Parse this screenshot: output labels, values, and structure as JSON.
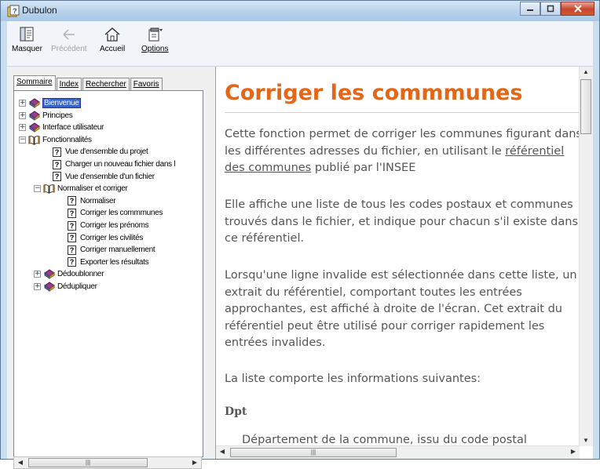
{
  "window": {
    "title": "Dubulon"
  },
  "toolbar": {
    "hide_label": "Masquer",
    "back_label": "Précédent",
    "home_label": "Accueil",
    "options_label": "Options"
  },
  "tabs": [
    "Sommaire",
    "Index",
    "Rechercher",
    "Favoris"
  ],
  "tree": [
    {
      "label": "Bienvenue",
      "icon": "book-icon",
      "expander": "+",
      "selected": true
    },
    {
      "label": "Principes",
      "icon": "book-icon",
      "expander": "+"
    },
    {
      "label": "Interface utilisateur",
      "icon": "book-icon",
      "expander": "+"
    },
    {
      "label": "Fonctionnalités",
      "icon": "open-book-icon",
      "expander": "-"
    },
    {
      "label": "Vue d'ensemble du projet",
      "icon": "help-page-icon"
    },
    {
      "label": "Charger un nouveau fichier dans l",
      "icon": "help-page-icon"
    },
    {
      "label": "Vue d'ensemble d'un fichier",
      "icon": "help-page-icon"
    },
    {
      "label": "Normaliser et corriger",
      "icon": "open-book-icon",
      "expander": "-"
    },
    {
      "label": "Normaliser",
      "icon": "help-page-icon"
    },
    {
      "label": "Corriger les commmunes",
      "icon": "help-page-icon"
    },
    {
      "label": "Corriger les prénoms",
      "icon": "help-page-icon"
    },
    {
      "label": "Corriger les civilités",
      "icon": "help-page-icon"
    },
    {
      "label": "Corriger manuellement",
      "icon": "help-page-icon"
    },
    {
      "label": "Exporter les résultats",
      "icon": "help-page-icon"
    },
    {
      "label": "Dédoublonner",
      "icon": "book-icon",
      "expander": "+"
    },
    {
      "label": "Dédupliquer",
      "icon": "book-icon",
      "expander": "+"
    }
  ],
  "doc": {
    "title": "Corriger les commmunes",
    "p1_before": "Cette fonction permet de corriger les communes figurant dans les différentes adresses du fichier, en utilisant le ",
    "p1_link": "référentiel des communes",
    "p1_after": " publié par l'INSEE",
    "p2": "Elle affiche une liste de tous les codes postaux et communes trouvés dans le fichier, et indique pour chacun s'il existe dans ce référentiel.",
    "p3": "Lorsqu'une ligne invalide est sélectionnée dans cette liste, un extrait du référentiel, comportant toutes les entrées approchantes, est affiché à droite de l'écran. Cet extrait du référentiel peut être utilisé pour corriger rapidement les entrées invalides.",
    "p4": "La liste comporte les informations suivantes:",
    "term": "Dpt",
    "term_def": "Département de la commune, issu du code postal"
  },
  "colors": {
    "title_orange": "#e46617",
    "selection": "#3366cc"
  }
}
